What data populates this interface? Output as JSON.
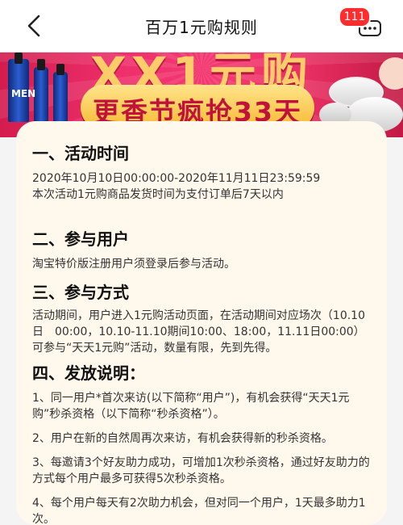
{
  "nav": {
    "title": "百万1元购规则",
    "badge": "111"
  },
  "banner": {
    "slogan": "更香节疯抢33天",
    "big_text": "XX1元购",
    "product_label": "MEN"
  },
  "sections": [
    {
      "heading": "一、活动时间",
      "paragraphs": [
        "2020年10月10日00:00:00-2020年11月11日23:59:59",
        "本次活动1元购商品发货时间为支付订单后7天以内"
      ]
    },
    {
      "heading": "二、参与用户",
      "paragraphs": [
        "淘宝特价版注册用户须登录后参与活动。"
      ]
    },
    {
      "heading": "三、参与方式",
      "paragraphs": [
        "活动期间，用户进入1元购活动页面，在活动期间对应场次（10.10日　00:00，10.10-11.10期间10:00、18:00，11.11日00:00）可参与“天天1元购”活动，数量有限，先到先得。"
      ]
    },
    {
      "heading": "四、发放说明：",
      "paragraphs": [
        "1、同一用户*首次来访(以下简称“用户”)，有机会获得“天天1元购”秒杀资格（以下简称“秒杀资格”）。",
        "2、用户在新的自然周再次来访，有机会获得新的秒杀资格。",
        "3、每邀请3个好友助力成功，可增加1次秒杀资格，通过好友助力的方式每个用户最多可获得5次秒杀资格。",
        "4、每个用户每天有2次助力机会，但对同一个用户，1天最多助力1次。"
      ]
    }
  ]
}
